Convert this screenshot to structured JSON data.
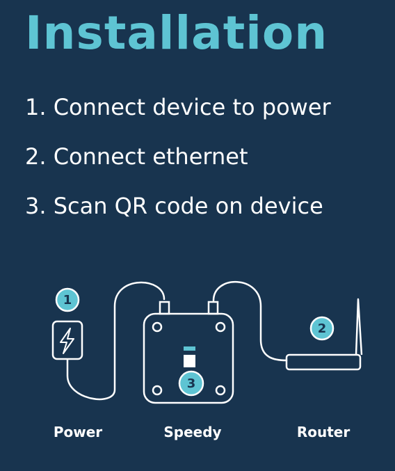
{
  "title": "Installation",
  "steps": [
    "1. Connect device to power",
    "2. Connect ethernet",
    "3. Scan QR code on device"
  ],
  "diagram": {
    "badges": [
      "1",
      "2",
      "3"
    ],
    "labels": {
      "power": "Power",
      "speedy": "Speedy",
      "router": "Router"
    }
  },
  "colors": {
    "background": "#18344f",
    "accent": "#5ec4d3",
    "text": "#ffffff"
  },
  "icons": [
    "lightning-bolt-icon"
  ]
}
